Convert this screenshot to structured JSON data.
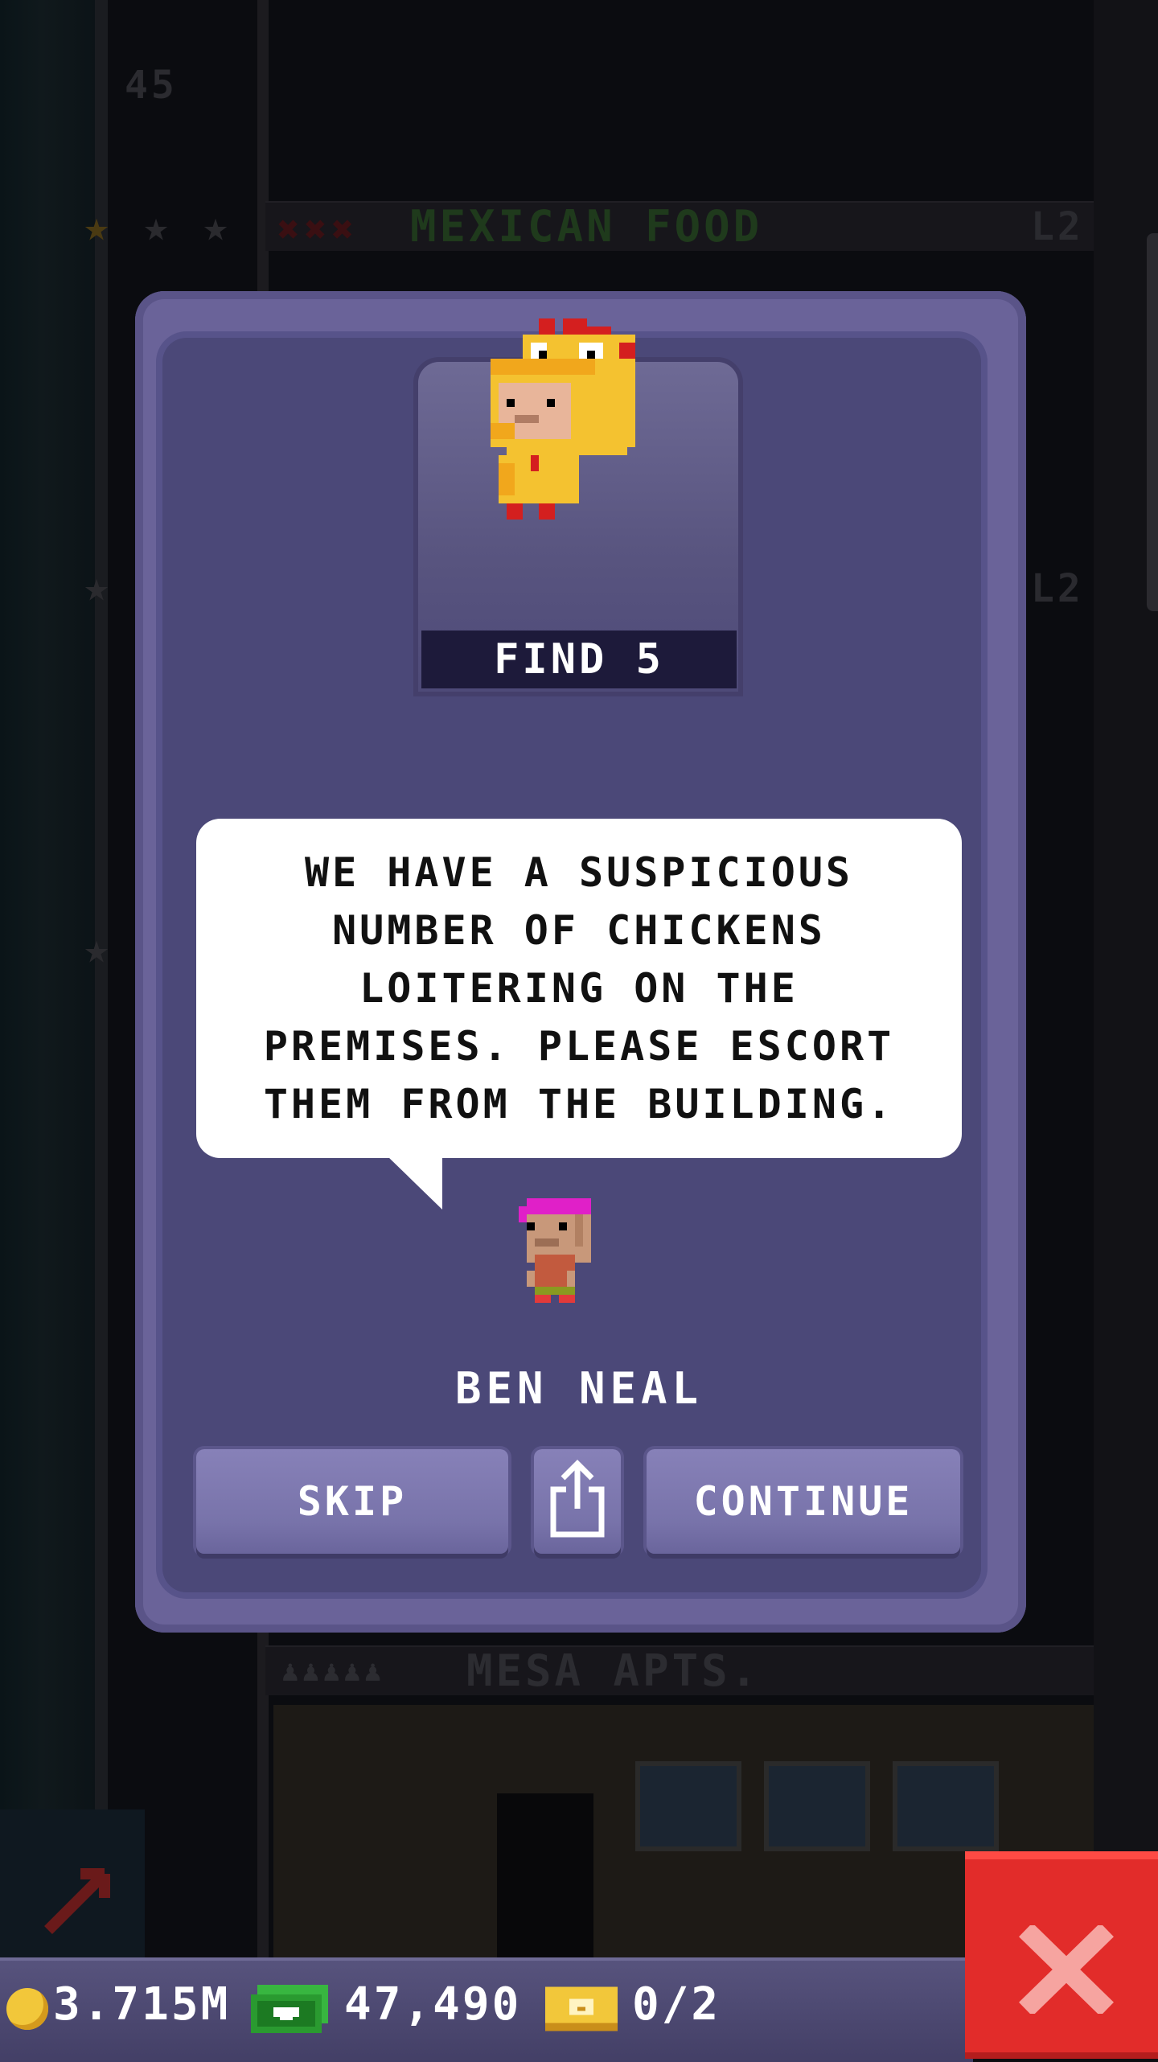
{
  "background": {
    "floor_number": "45",
    "floor_top_label": "MEXICAN FOOD",
    "floor_top_level": "L2",
    "floor_mid_level": "L2",
    "floor_bottom_label": "MESA APTS.",
    "stars_earned": 1,
    "stars_total": 3
  },
  "dialog": {
    "mission_label": "FIND 5",
    "message": "WE HAVE A SUSPICIOUS NUMBER OF CHICKENS LOITERING ON THE PREMISES. PLEASE ESCORT THEM FROM THE BUILDING.",
    "npc_name": "BEN NEAL",
    "skip_label": "SKIP",
    "continue_label": "CONTINUE",
    "share_icon": "share-icon"
  },
  "status_bar": {
    "coins": "3.715M",
    "bux": "47,490",
    "tickets": "0/2"
  },
  "colors": {
    "dialog_outer": "#6a6399",
    "dialog_inner": "#4b4878",
    "button": "#7873aa",
    "close_red": "#e22c2a",
    "floor_label_green": "#1f4a1f"
  }
}
